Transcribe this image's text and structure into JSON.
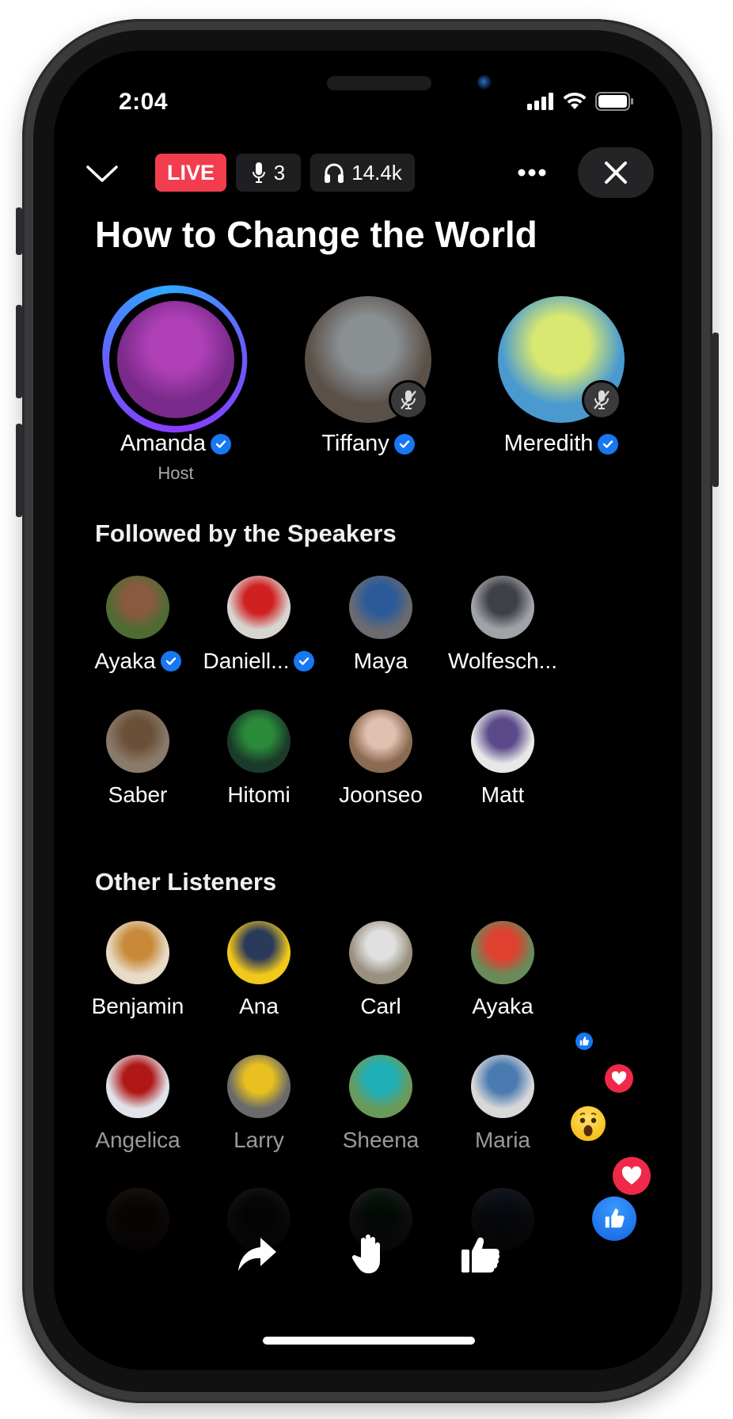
{
  "status_bar": {
    "time": "2:04",
    "signal_icon": "cellular-signal-icon",
    "wifi_icon": "wifi-icon",
    "battery_icon": "battery-icon"
  },
  "topbar": {
    "collapse_icon": "chevron-down-icon",
    "live_label": "LIVE",
    "speakers_count": "3",
    "listeners_count": "14.4k",
    "more_icon": "more-dots-icon",
    "close_icon": "close-icon"
  },
  "room": {
    "title": "How to Change the World"
  },
  "speakers": [
    {
      "name": "Amanda",
      "verified": true,
      "role": "Host",
      "muted": false,
      "speaking": true,
      "colors": [
        "#7a2a8a",
        "#b040b8"
      ]
    },
    {
      "name": "Tiffany",
      "verified": true,
      "role": "",
      "muted": true,
      "speaking": false,
      "colors": [
        "#5a5048",
        "#8a8f92"
      ]
    },
    {
      "name": "Meredith",
      "verified": true,
      "role": "",
      "muted": true,
      "speaking": false,
      "colors": [
        "#4a9ad0",
        "#d8e870"
      ]
    }
  ],
  "sections": {
    "followed": {
      "title": "Followed by the Speakers",
      "people": [
        {
          "name": "Ayaka",
          "verified": true,
          "colors": [
            "#4e6b32",
            "#8a5a40"
          ]
        },
        {
          "name": "Daniell...",
          "verified": true,
          "colors": [
            "#d8d4d0",
            "#d02020"
          ]
        },
        {
          "name": "Maya",
          "verified": false,
          "colors": [
            "#6a6a70",
            "#2a5a9a"
          ]
        },
        {
          "name": "Wolfesch...",
          "verified": false,
          "colors": [
            "#a0a4a8",
            "#404048"
          ]
        },
        {
          "name": "Saber",
          "verified": false,
          "colors": [
            "#8a7a6a",
            "#6a5038"
          ]
        },
        {
          "name": "Hitomi",
          "verified": false,
          "colors": [
            "#1a3a2a",
            "#2a8a3a"
          ]
        },
        {
          "name": "Joonseo",
          "verified": false,
          "colors": [
            "#8a6a50",
            "#e0c0b0"
          ]
        },
        {
          "name": "Matt",
          "verified": false,
          "colors": [
            "#e8e8e8",
            "#5a4a8a"
          ]
        }
      ]
    },
    "others": {
      "title": "Other Listeners",
      "people": [
        {
          "name": "Benjamin",
          "colors": [
            "#e8dcc8",
            "#c88a3a"
          ]
        },
        {
          "name": "Ana",
          "colors": [
            "#f2c81a",
            "#2a3a5a"
          ]
        },
        {
          "name": "Carl",
          "colors": [
            "#9a9080",
            "#e0e0e0"
          ]
        },
        {
          "name": "Ayaka",
          "colors": [
            "#6a8a5a",
            "#e04030"
          ]
        },
        {
          "name": "Angelica",
          "colors": [
            "#e0e4ea",
            "#b01818"
          ]
        },
        {
          "name": "Larry",
          "colors": [
            "#6a6a6a",
            "#e8c020"
          ]
        },
        {
          "name": "Sheena",
          "colors": [
            "#6a9a5a",
            "#20b0b8"
          ]
        },
        {
          "name": "Maria",
          "colors": [
            "#d8d8d8",
            "#4a7ab0"
          ]
        }
      ],
      "partial_row_colors": [
        [
          "#5a4030",
          "#2a2018"
        ],
        [
          "#4a4a40",
          "#1a1a1a"
        ],
        [
          "#6a6a6a",
          "#1a4a2a"
        ],
        [
          "#505050",
          "#2a3a5a"
        ]
      ]
    }
  },
  "actions": {
    "share_icon": "share-icon",
    "raise_hand_icon": "raise-hand-icon",
    "like_icon": "thumbs-up-icon"
  },
  "reactions": [
    "like",
    "love",
    "wow",
    "love",
    "like"
  ],
  "colors": {
    "live": "#f23d4f",
    "verified": "#1877f2",
    "love": "#f0284a",
    "like": "#1877f2",
    "speaking_ring": [
      "#2ea8ff",
      "#8a3cff"
    ]
  }
}
